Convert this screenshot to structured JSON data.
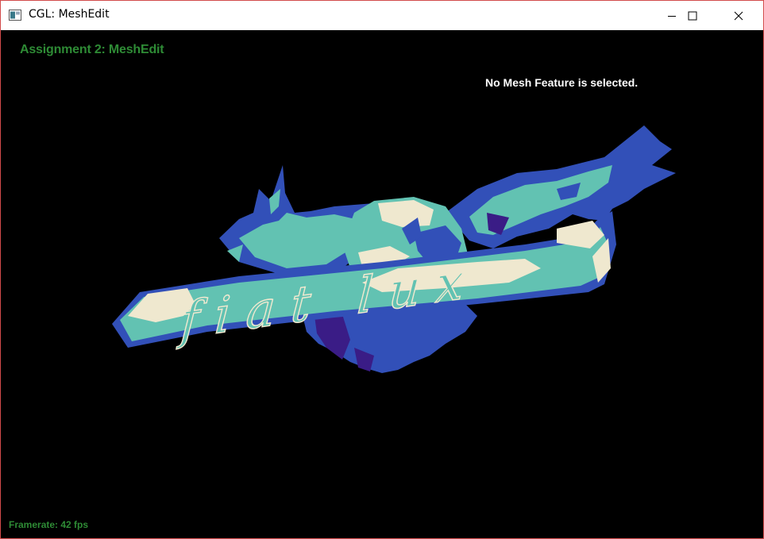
{
  "window": {
    "title": "CGL: MeshEdit",
    "icon": "app-window-icon",
    "controls": {
      "minimize": "minimize-icon",
      "maximize": "maximize-icon",
      "close": "close-icon"
    }
  },
  "viewport": {
    "assignment_title": "Assignment 2: MeshEdit",
    "status": "No Mesh Feature is selected.",
    "framerate": "Framerate: 42 fps",
    "banner_text": "fiat lux"
  },
  "colors": {
    "background": "#000000",
    "label_green": "#2e8b35",
    "mesh_teal": "#62c2b2",
    "mesh_blue": "#3250b8",
    "mesh_cream": "#efe8cf",
    "mesh_indigo": "#3a1c86"
  }
}
